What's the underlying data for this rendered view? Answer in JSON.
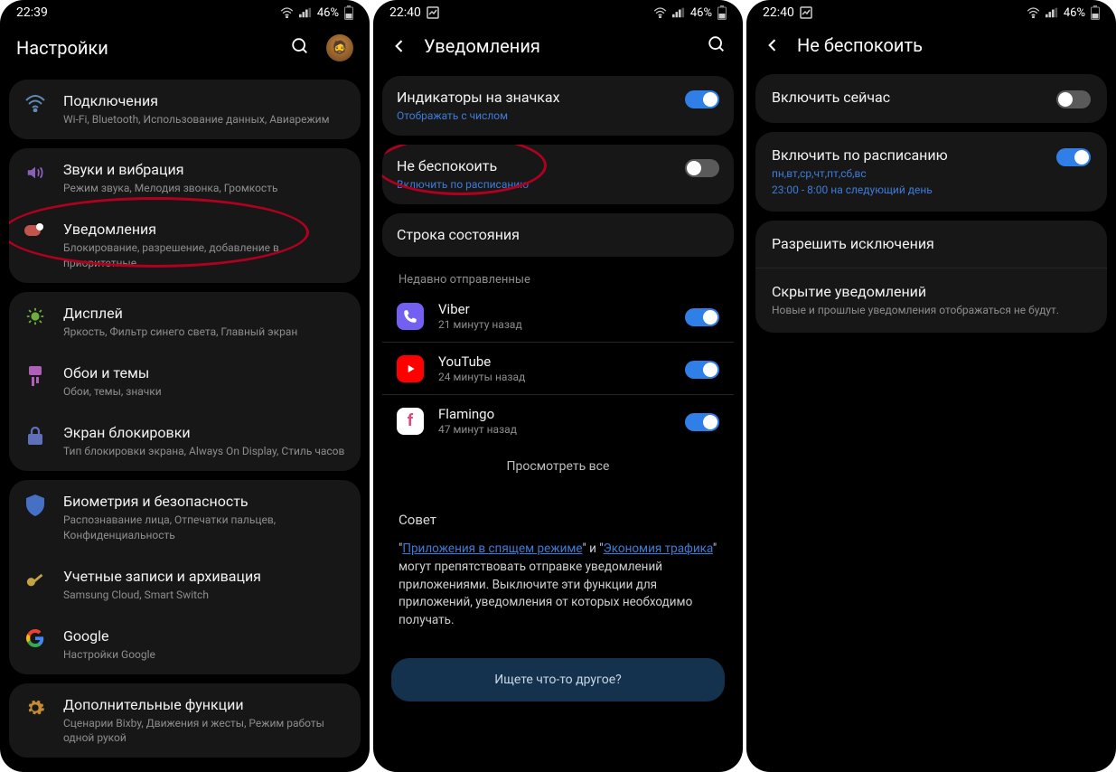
{
  "screen1": {
    "status": {
      "time": "22:39",
      "battery": "46%"
    },
    "title": "Настройки",
    "groups": [
      {
        "items": [
          {
            "icon": "wifi",
            "title": "Подключения",
            "sub": "Wi-Fi, Bluetooth, Использование данных, Авиарежим"
          }
        ]
      },
      {
        "items": [
          {
            "icon": "sound",
            "title": "Звуки и вибрация",
            "sub": "Режим звука, Мелодия звонка, Громкость"
          },
          {
            "icon": "notif",
            "title": "Уведомления",
            "sub": "Блокирование, разрешение, добавление в приоритетные",
            "highlight": true
          }
        ]
      },
      {
        "items": [
          {
            "icon": "display",
            "title": "Дисплей",
            "sub": "Яркость, Фильтр синего света, Главный экран"
          },
          {
            "icon": "wall",
            "title": "Обои и темы",
            "sub": "Обои, темы, значки"
          },
          {
            "icon": "lock",
            "title": "Экран блокировки",
            "sub": "Тип блокировки экрана, Always On Display, Стиль часов"
          }
        ]
      },
      {
        "items": [
          {
            "icon": "bio",
            "title": "Биометрия и безопасность",
            "sub": "Распознавание лица, Отпечатки пальцев, Конфиденциальность"
          },
          {
            "icon": "acct",
            "title": "Учетные записи и архивация",
            "sub": "Samsung Cloud, Smart Switch"
          },
          {
            "icon": "google",
            "title": "Google",
            "sub": "Настройки Google"
          }
        ]
      },
      {
        "items": [
          {
            "icon": "adv",
            "title": "Дополнительные функции",
            "sub": "Сценарии Bixby, Движения и жесты, Режим работы одной рукой"
          }
        ]
      }
    ]
  },
  "screen2": {
    "status": {
      "time": "22:40",
      "battery": "46%"
    },
    "title": "Уведомления",
    "badge": {
      "title": "Индикаторы на значках",
      "sub": "Отображать с числом",
      "on": true
    },
    "dnd": {
      "title": "Не беспокоить",
      "sub": "Включить по расписанию",
      "on": false,
      "highlight": true
    },
    "statusBarRow": {
      "title": "Строка состояния"
    },
    "recentLabel": "Недавно отправленные",
    "apps": [
      {
        "name": "Viber",
        "sub": "21 минуту назад",
        "on": true,
        "color": "#7360f2"
      },
      {
        "name": "YouTube",
        "sub": "24 минуты назад",
        "on": true,
        "color": "#ff0000"
      },
      {
        "name": "Flamingo",
        "sub": "47 минут назад",
        "on": true,
        "color": "#ffffff"
      }
    ],
    "viewAll": "Просмотреть все",
    "tipTitle": "Совет",
    "tipPrefix": "\"",
    "tipLink1": "Приложения в спящем режиме",
    "tipMid": "\" и \"",
    "tipLink2": "Экономия трафика",
    "tipRest": "\" могут препятствовать отправке уведомлений приложениями. Выключите эти функции для приложений, уведомления от которых необходимо получать.",
    "searchPrompt": "Ищете что-то другое?"
  },
  "screen3": {
    "status": {
      "time": "22:40",
      "battery": "46%"
    },
    "title": "Не беспокоить",
    "enableNow": {
      "title": "Включить сейчас",
      "on": false
    },
    "schedule": {
      "title": "Включить по расписанию",
      "sub1": "пн,вт,ср,чт,пт,сб,вс",
      "sub2": "23:00 - 8:00 на следующий день",
      "on": true
    },
    "exceptions": {
      "title": "Разрешить исключения"
    },
    "hide": {
      "title": "Скрытие уведомлений",
      "sub": "Новые и прошлые уведомления отображаться не будут."
    }
  }
}
